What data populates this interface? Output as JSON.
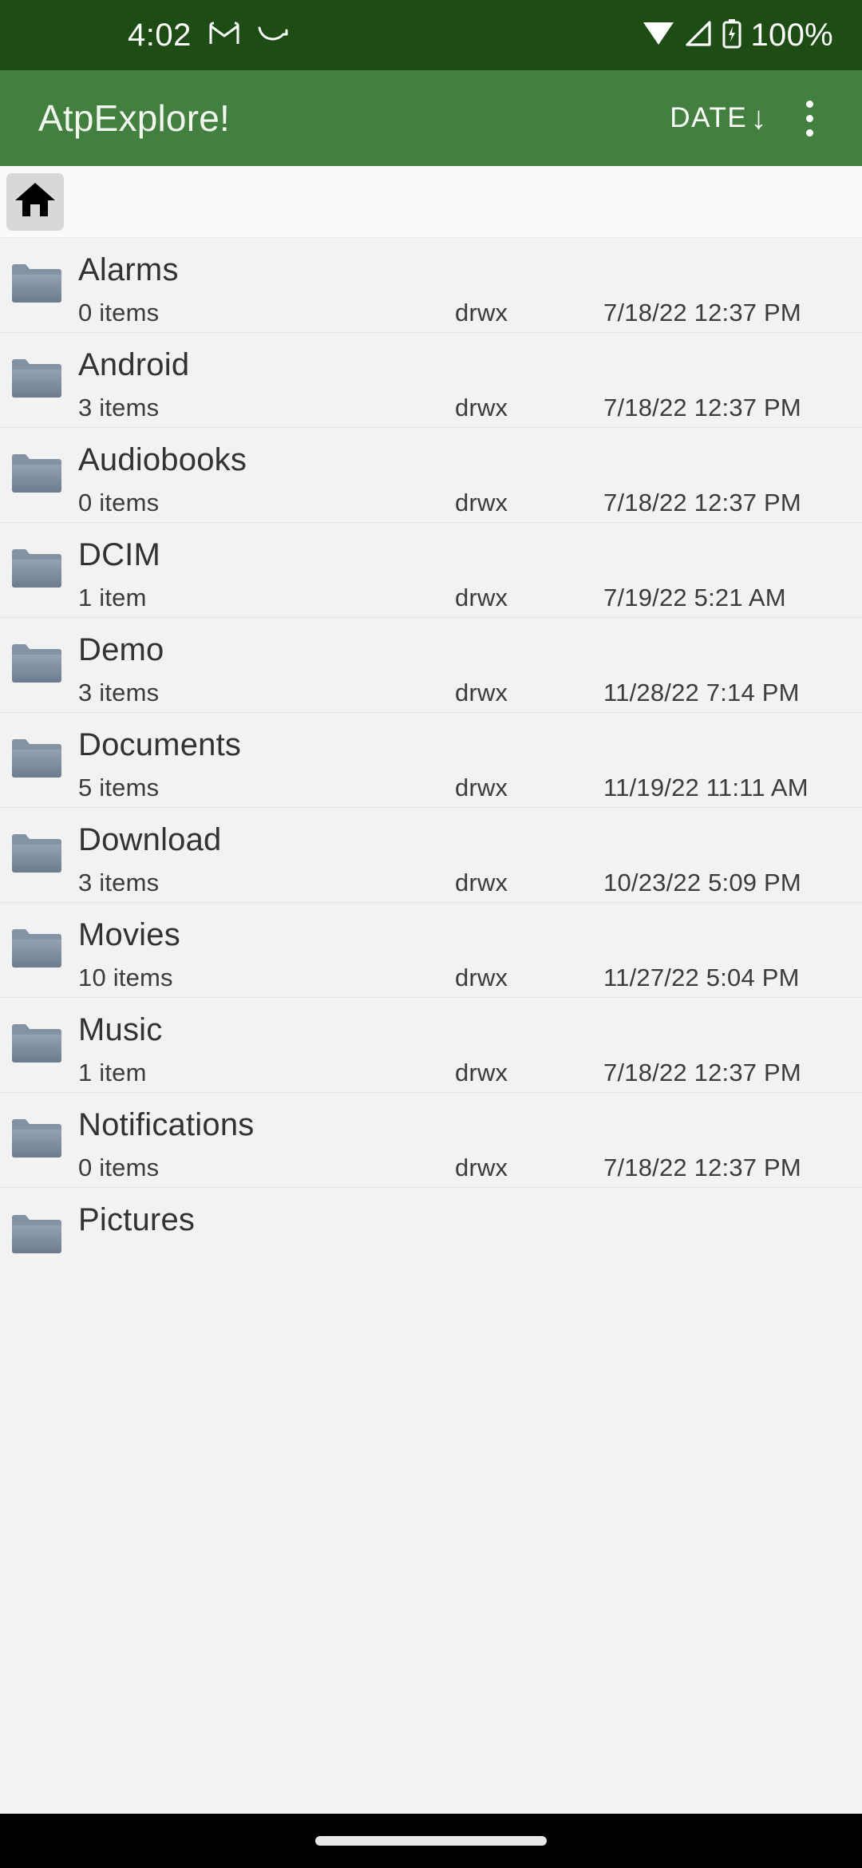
{
  "status_bar": {
    "time": "4:02",
    "battery_percent": "100%",
    "icons": [
      "gmail-icon",
      "swipe-gesture-icon",
      "wifi-icon",
      "cellular-signal-icon",
      "battery-charging-icon"
    ],
    "background_color": "#1d4d14"
  },
  "app_bar": {
    "title": "AtpExplore!",
    "sort_label": "DATE",
    "sort_direction_glyph": "↓",
    "overflow_label": "More options",
    "background_color": "#43803f"
  },
  "breadcrumb": {
    "home_label": "Home",
    "icon": "home-icon"
  },
  "columns": [
    "name",
    "items",
    "permissions",
    "modified"
  ],
  "files": [
    {
      "name": "Alarms",
      "items": "0 items",
      "permissions": "drwx",
      "modified": "7/18/22 12:37 PM",
      "icon": "folder-icon"
    },
    {
      "name": "Android",
      "items": "3 items",
      "permissions": "drwx",
      "modified": "7/18/22 12:37 PM",
      "icon": "folder-icon"
    },
    {
      "name": "Audiobooks",
      "items": "0 items",
      "permissions": "drwx",
      "modified": "7/18/22 12:37 PM",
      "icon": "folder-icon"
    },
    {
      "name": "DCIM",
      "items": "1 item",
      "permissions": "drwx",
      "modified": "7/19/22 5:21 AM",
      "icon": "folder-icon"
    },
    {
      "name": "Demo",
      "items": "3 items",
      "permissions": "drwx",
      "modified": "11/28/22 7:14 PM",
      "icon": "folder-icon"
    },
    {
      "name": "Documents",
      "items": "5 items",
      "permissions": "drwx",
      "modified": "11/19/22 11:11 AM",
      "icon": "folder-icon"
    },
    {
      "name": "Download",
      "items": "3 items",
      "permissions": "drwx",
      "modified": "10/23/22 5:09 PM",
      "icon": "folder-icon"
    },
    {
      "name": "Movies",
      "items": "10 items",
      "permissions": "drwx",
      "modified": "11/27/22 5:04 PM",
      "icon": "folder-icon"
    },
    {
      "name": "Music",
      "items": "1 item",
      "permissions": "drwx",
      "modified": "7/18/22 12:37 PM",
      "icon": "folder-icon"
    },
    {
      "name": "Notifications",
      "items": "0 items",
      "permissions": "drwx",
      "modified": "7/18/22 12:37 PM",
      "icon": "folder-icon"
    },
    {
      "name": "Pictures",
      "items": "",
      "permissions": "",
      "modified": "",
      "icon": "folder-icon"
    }
  ],
  "nav_bar": {
    "gesture_handle": "home-gesture-pill"
  }
}
